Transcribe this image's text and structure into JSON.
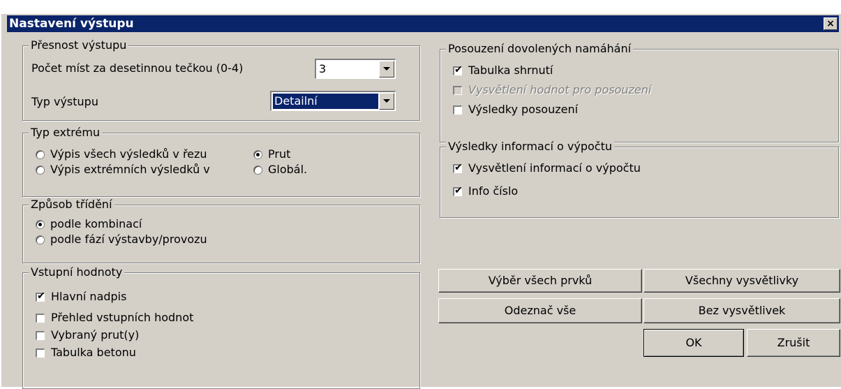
{
  "window": {
    "title": "Nastavení výstupu",
    "close_label": "×"
  },
  "output_precision": {
    "title": "Přesnost výstupu",
    "decimals_label": "Počet míst za desetinnou tečkou (0-4)",
    "decimals_value": "3",
    "type_label": "Typ výstupu",
    "type_value": "Detailní"
  },
  "extreme_type": {
    "title": "Typ extrému",
    "options": [
      {
        "label": "Výpis všech výsledků v řezu",
        "selected": false
      },
      {
        "label": "Výpis extrémních výsledků v",
        "selected": false
      },
      {
        "label": "Prut",
        "selected": true
      },
      {
        "label": "Globál.",
        "selected": false
      }
    ]
  },
  "sorting": {
    "title": "Způsob třídění",
    "options": [
      {
        "label": "podle kombinací",
        "selected": true
      },
      {
        "label": "podle fází výstavby/provozu",
        "selected": false
      }
    ]
  },
  "input_values": {
    "title": "Vstupní hodnoty",
    "items": [
      {
        "label": "Hlavní nadpis",
        "checked": true
      },
      {
        "label": "Přehled vstupních hodnot",
        "checked": false
      },
      {
        "label": "Vybraný prut(y)",
        "checked": false
      },
      {
        "label": "Tabulka betonu",
        "checked": false
      }
    ]
  },
  "stress_check": {
    "title": "Posouzení dovolených namáhání",
    "items": [
      {
        "label": "Tabulka shrnutí",
        "checked": true,
        "enabled": true
      },
      {
        "label": "Vysvětlení hodnot pro posouzení",
        "checked": false,
        "enabled": false
      },
      {
        "label": "Výsledky posouzení",
        "checked": false,
        "enabled": true
      }
    ]
  },
  "calc_info": {
    "title": "Výsledky informací o výpočtu",
    "items": [
      {
        "label": "Vysvětlení informací o výpočtu",
        "checked": true
      },
      {
        "label": "Info číslo",
        "checked": true
      }
    ]
  },
  "buttons": {
    "select_all": "Výběr všech prvků",
    "all_explanations": "Všechny vysvětlivky",
    "deselect_all": "Odeznač vše",
    "no_explanations": "Bez vysvětlivek",
    "ok": "OK",
    "cancel": "Zrušit"
  },
  "colors": {
    "title_bar": "#0a246a",
    "dialog_bg": "#d4d0c8"
  }
}
